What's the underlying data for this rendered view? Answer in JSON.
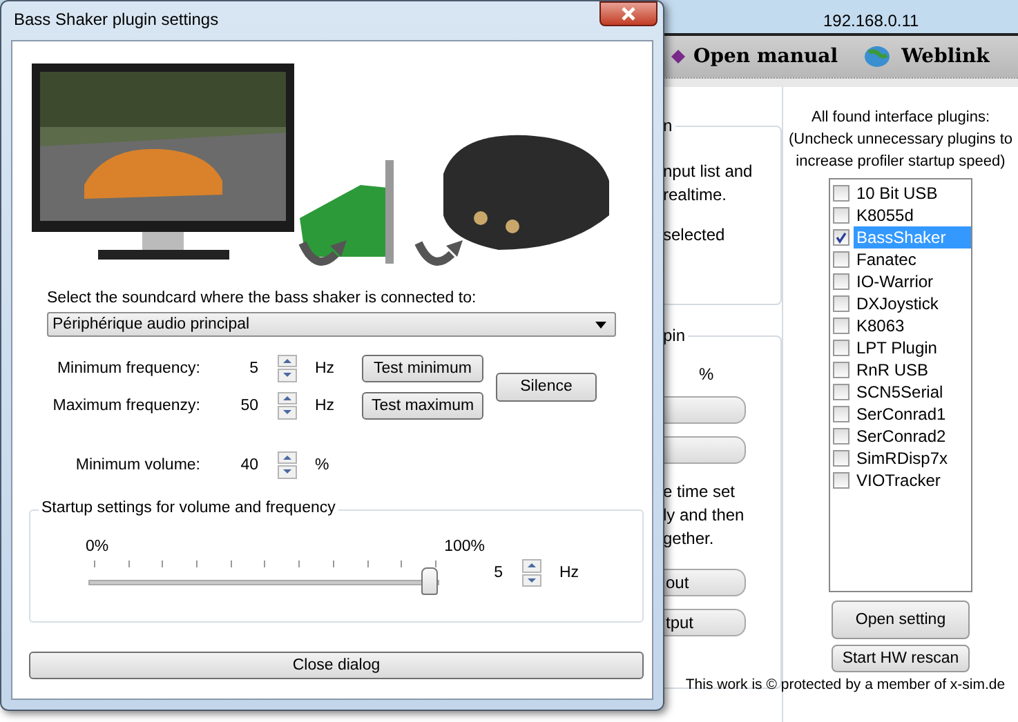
{
  "app": {
    "address": "192.168.0.11",
    "toolbar": [
      {
        "kind": "manual",
        "label": "Open manual"
      },
      {
        "kind": "web",
        "label": "Weblink"
      }
    ],
    "hidden_panel": {
      "group_1": {
        "title": "n",
        "lines": [
          "nput list and",
          "realtime.",
          "selected"
        ]
      },
      "group_2": {
        "title": "pin",
        "unit": "%",
        "lines": [
          "e time set",
          "ly and then",
          "gether."
        ],
        "lower_buttons": [
          "out",
          "tput"
        ]
      }
    },
    "plugins": {
      "header": "All found interface plugins:",
      "hint": "(Uncheck unnecessary plugins to increase profiler startup speed)",
      "items": [
        {
          "label": "10 Bit USB",
          "checked": false,
          "selected": false
        },
        {
          "label": "K8055d",
          "checked": false,
          "selected": false
        },
        {
          "label": "BassShaker",
          "checked": true,
          "selected": true
        },
        {
          "label": "Fanatec",
          "checked": false,
          "selected": false
        },
        {
          "label": "IO-Warrior",
          "checked": false,
          "selected": false
        },
        {
          "label": "DXJoystick",
          "checked": false,
          "selected": false
        },
        {
          "label": "K8063",
          "checked": false,
          "selected": false
        },
        {
          "label": "LPT Plugin",
          "checked": false,
          "selected": false
        },
        {
          "label": "RnR USB",
          "checked": false,
          "selected": false
        },
        {
          "label": "SCN5Serial",
          "checked": false,
          "selected": false
        },
        {
          "label": "SerConrad1",
          "checked": false,
          "selected": false
        },
        {
          "label": "SerConrad2",
          "checked": false,
          "selected": false
        },
        {
          "label": "SimRDisp7x",
          "checked": false,
          "selected": false
        },
        {
          "label": "VIOTracker",
          "checked": false,
          "selected": false
        }
      ],
      "buttons": [
        "Open setting",
        "Start HW rescan"
      ]
    },
    "footer": "This work is © protected by a member of x-sim.de"
  },
  "dialog": {
    "title": "Bass Shaker plugin settings",
    "soundcard_label": "Select the soundcard where the bass shaker is connected to:",
    "soundcard_value": "Périphérique audio principal",
    "frequencies": [
      {
        "label": "Minimum frequency:",
        "value": "5",
        "unit": "Hz",
        "button": "Test minimum"
      },
      {
        "label": "Maximum frequenzy:",
        "value": "50",
        "unit": "Hz",
        "button": "Test maximum"
      }
    ],
    "silence_button": "Silence",
    "volume": {
      "label": "Minimum volume:",
      "value": "40",
      "unit": "%"
    },
    "startup": {
      "title": "Startup settings for volume and frequency",
      "min_label": "0%",
      "max_label": "100%",
      "level": 1,
      "value": "5",
      "unit": "Hz"
    },
    "close_button": "Close dialog"
  }
}
